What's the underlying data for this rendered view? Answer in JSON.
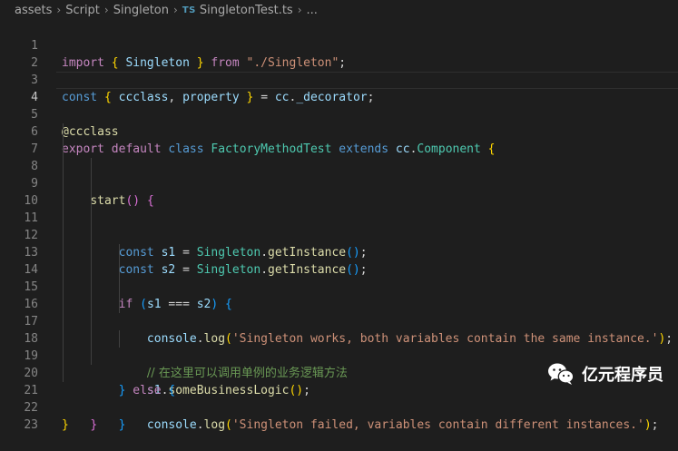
{
  "breadcrumb": {
    "items": [
      "assets",
      "Script",
      "Singleton"
    ],
    "file_badge": "TS",
    "file_name": "SingletonTest.ts",
    "more": "..."
  },
  "editor": {
    "current_line": 4,
    "lines": [
      {
        "n": "1"
      },
      {
        "n": "2"
      },
      {
        "n": "3"
      },
      {
        "n": "4"
      },
      {
        "n": "5"
      },
      {
        "n": "6"
      },
      {
        "n": "7"
      },
      {
        "n": "8"
      },
      {
        "n": "9"
      },
      {
        "n": "10"
      },
      {
        "n": "11"
      },
      {
        "n": "12"
      },
      {
        "n": "13"
      },
      {
        "n": "14"
      },
      {
        "n": "15"
      },
      {
        "n": "16"
      },
      {
        "n": "17"
      },
      {
        "n": "18"
      },
      {
        "n": "19"
      },
      {
        "n": "20"
      },
      {
        "n": "21"
      },
      {
        "n": "22"
      },
      {
        "n": "23"
      }
    ],
    "tokens": {
      "import": "import",
      "Singleton": "Singleton",
      "from": "from",
      "path": "\"./Singleton\"",
      "const": "const",
      "ccclass": "ccclass",
      "property": "property",
      "cc": "cc",
      "decorator": "_decorator",
      "at_ccclass": "@ccclass",
      "export": "export",
      "default": "default",
      "class": "class",
      "FactoryMethodTest": "FactoryMethodTest",
      "extends": "extends",
      "Component": "Component",
      "start": "start",
      "s1": "s1",
      "s2": "s2",
      "getInstance": "getInstance",
      "if": "if",
      "console": "console",
      "log": "log",
      "msg_ok": "'Singleton works, both variables contain the same instance.'",
      "comment": "// 在这里可以调用单例的业务逻辑方法",
      "someBusinessLogic": "someBusinessLogic",
      "else": "else",
      "msg_fail": "'Singleton failed, variables contain different instances.'"
    }
  },
  "watermark": {
    "text": "亿元程序员",
    "icon": "wechat-icon"
  },
  "colors": {
    "background": "#1e1e1e",
    "keyword": "#569cd6",
    "control": "#c586c0",
    "string": "#ce9178",
    "variable": "#9cdcfe",
    "type": "#4ec9b0",
    "function": "#dcdcaa",
    "comment": "#6a9955",
    "bracket1": "#ffd700",
    "bracket2": "#da70d6",
    "bracket3": "#179fff"
  }
}
